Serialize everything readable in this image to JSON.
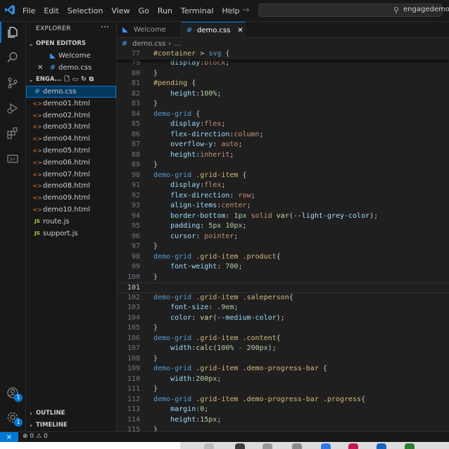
{
  "menu": [
    "File",
    "Edit",
    "Selection",
    "View",
    "Go",
    "Run",
    "Terminal",
    "Help"
  ],
  "search": {
    "text": "engagedemo"
  },
  "explorer": {
    "title": "EXPLORER",
    "more": "···",
    "open_editors": {
      "label": "OPEN EDITORS",
      "items": [
        {
          "name": "Welcome",
          "close": ""
        },
        {
          "name": "demo.css",
          "close": "✕"
        }
      ]
    },
    "folder": {
      "label": "ENGA...",
      "files": [
        {
          "name": "demo.css",
          "type": "css"
        },
        {
          "name": "demo01.html",
          "type": "html"
        },
        {
          "name": "demo02.html",
          "type": "html"
        },
        {
          "name": "demo03.html",
          "type": "html"
        },
        {
          "name": "demo04.html",
          "type": "html"
        },
        {
          "name": "demo05.html",
          "type": "html"
        },
        {
          "name": "demo06.html",
          "type": "html"
        },
        {
          "name": "demo07.html",
          "type": "html"
        },
        {
          "name": "demo08.html",
          "type": "html"
        },
        {
          "name": "demo09.html",
          "type": "html"
        },
        {
          "name": "demo10.html",
          "type": "html"
        },
        {
          "name": "route.js",
          "type": "js"
        },
        {
          "name": "support.js",
          "type": "js"
        }
      ]
    },
    "outline": "OUTLINE",
    "timeline": "TIMELINE"
  },
  "tabs": [
    {
      "label": "Welcome"
    },
    {
      "label": "demo.css",
      "close": "✕"
    }
  ],
  "breadcrumb": {
    "file": "demo.css",
    "rest": "..."
  },
  "activity_badges": {
    "accounts": "1",
    "manage": "1"
  },
  "status": {
    "errors": "0",
    "warnings": "0"
  },
  "code_lines": [
    {
      "n": "77",
      "t": "#container > svg {"
    },
    {
      "n": "79",
      "t": "    display:block;"
    },
    {
      "n": "80",
      "t": "}"
    },
    {
      "n": "81",
      "t": "#pending {"
    },
    {
      "n": "82",
      "t": "    height:100%;"
    },
    {
      "n": "83",
      "t": "}"
    },
    {
      "n": "84",
      "t": "demo-grid {"
    },
    {
      "n": "85",
      "t": "    display:flex;"
    },
    {
      "n": "86",
      "t": "    flex-direction:column;"
    },
    {
      "n": "87",
      "t": "    overflow-y: auto;"
    },
    {
      "n": "88",
      "t": "    height:inherit;"
    },
    {
      "n": "89",
      "t": "}"
    },
    {
      "n": "90",
      "t": "demo-grid .grid-item {"
    },
    {
      "n": "91",
      "t": "    display:flex;"
    },
    {
      "n": "92",
      "t": "    flex-direction: row;"
    },
    {
      "n": "93",
      "t": "    align-items:center;"
    },
    {
      "n": "94",
      "t": "    border-bottom: 1px solid var(--light-grey-color);"
    },
    {
      "n": "95",
      "t": "    padding: 5px 10px;"
    },
    {
      "n": "96",
      "t": "    cursor: pointer;"
    },
    {
      "n": "97",
      "t": "}"
    },
    {
      "n": "98",
      "t": "demo-grid .grid-item .product{"
    },
    {
      "n": "99",
      "t": "    font-weight: 700;"
    },
    {
      "n": "100",
      "t": "}"
    },
    {
      "n": "101",
      "t": ""
    },
    {
      "n": "102",
      "t": "demo-grid .grid-item .saleperson{"
    },
    {
      "n": "103",
      "t": "    font-size: .9em;"
    },
    {
      "n": "104",
      "t": "    color: var(--medium-color);"
    },
    {
      "n": "105",
      "t": "}"
    },
    {
      "n": "106",
      "t": "demo-grid .grid-item .content{"
    },
    {
      "n": "107",
      "t": "    width:calc(100% - 200px);"
    },
    {
      "n": "108",
      "t": "}"
    },
    {
      "n": "109",
      "t": "demo-grid .grid-item .demo-progress-bar {"
    },
    {
      "n": "110",
      "t": "    width:200px;"
    },
    {
      "n": "111",
      "t": "}"
    },
    {
      "n": "112",
      "t": "demo-grid .grid-item .demo-progress-bar .progress{"
    },
    {
      "n": "113",
      "t": "    margin:0;"
    },
    {
      "n": "114",
      "t": "    height:15px;"
    },
    {
      "n": "115",
      "t": "}"
    }
  ],
  "colors": {
    "accent": "#0078d4",
    "selector": "#d7ba7d",
    "tag_selector": "#569cd6",
    "property": "#9cdcfe",
    "value": "#ce9178",
    "number": "#b5cea8",
    "punctuation": "#cccccc"
  }
}
